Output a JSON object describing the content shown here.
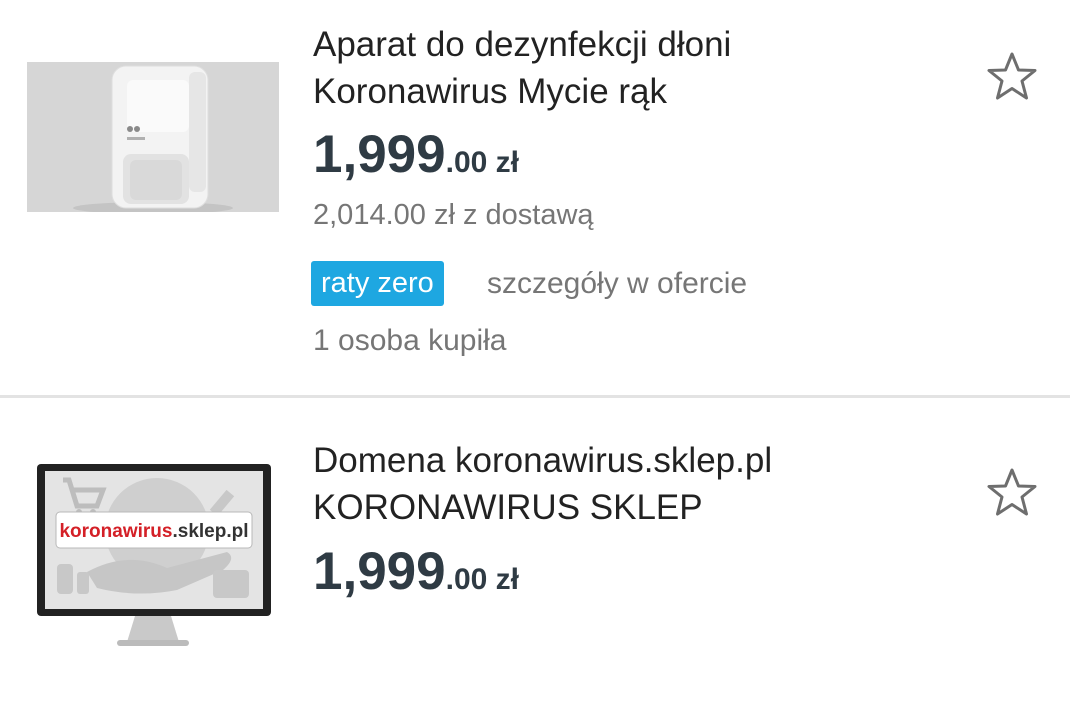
{
  "listings": [
    {
      "title_line1": "Aparat do dezynfekcji dłoni",
      "title_line2": "Koronawirus Mycie rąk",
      "price_main": "1,999",
      "price_small": ".00 zł",
      "shipping": "2,014.00 zł z dostawą",
      "badge": "raty zero",
      "details": "szczegóły w ofercie",
      "buyers": "1 osoba kupiła",
      "favorite_icon": "star-outline-icon"
    },
    {
      "title_line1": "Domena koronawirus.sklep.pl",
      "title_line2": "KORONAWIRUS SKLEP",
      "price_main": "1,999",
      "price_small": ".00 zł",
      "thumb_text_red": "koronawirus",
      "thumb_text_dark": ".sklep.pl",
      "favorite_icon": "star-outline-icon"
    }
  ],
  "colors": {
    "price": "#2f3b44",
    "badge": "#1ea7e1",
    "secondary_text": "#767676",
    "divider": "#e3e3e3"
  }
}
